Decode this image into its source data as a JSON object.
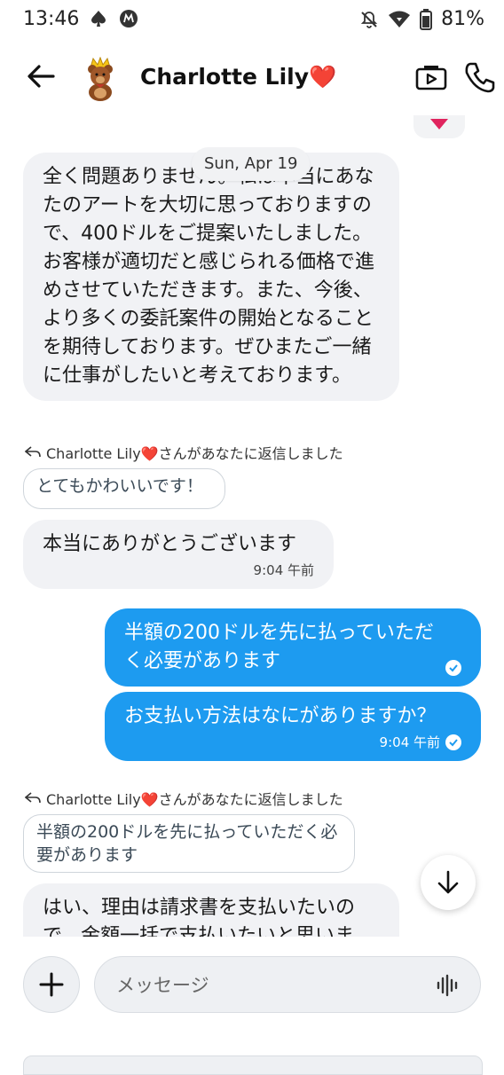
{
  "status_bar": {
    "time": "13:46",
    "battery": "81%"
  },
  "header": {
    "contact_name": "Charlotte Lily",
    "heart": "❤️"
  },
  "chat": {
    "date_label": "Sun, Apr 19",
    "messages": [
      {
        "type": "in",
        "text": "全く問題ありません。私は本当にあなたのアートを大切に思っておりますので、400ドルをご提案いたしました。お客様が適切だと感じられる価格で進めさせていただきます。また、今後、より多くの委託案件の開始となることを期待しております。ぜひまたご一緒に仕事がしたいと考えております。"
      },
      {
        "type": "reply_label",
        "text": "Charlotte Lily❤️さんがあなたに返信しました"
      },
      {
        "type": "quote",
        "text": "とてもかわいいです！"
      },
      {
        "type": "in",
        "text": "本当にありがとうございます",
        "time": "9:04 午前"
      },
      {
        "type": "out",
        "text": "半額の200ドルを先に払っていただく必要があります"
      },
      {
        "type": "out",
        "text": "お支払い方法はなにがありますか？",
        "time": "9:04 午前"
      },
      {
        "type": "reply_label",
        "text": "Charlotte Lily❤️さんがあなたに返信しました"
      },
      {
        "type": "quote",
        "text": "半額の200ドルを先に払っていただく必要があります"
      },
      {
        "type": "in",
        "text": "はい、理由は請求書を支払いたいので、金額一括で支払いたいと思いま"
      }
    ]
  },
  "composer": {
    "placeholder": "メッセージ"
  },
  "colors": {
    "accent": "#1d9bf0",
    "incoming_bubble": "#f1f2f5"
  }
}
